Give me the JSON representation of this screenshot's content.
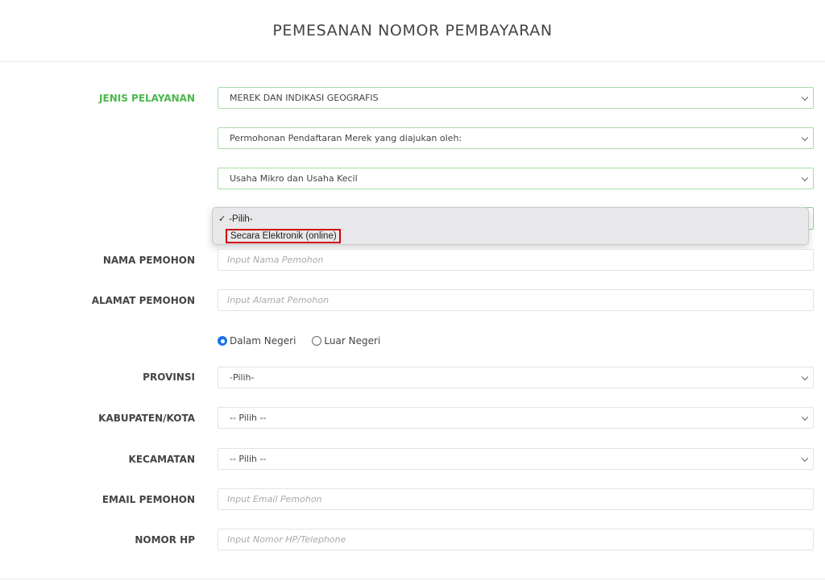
{
  "header": {
    "title": "PEMESANAN NOMOR PEMBAYARAN"
  },
  "form": {
    "jenis_pelayanan": {
      "label": "JENIS PELAYANAN",
      "select1": "MEREK DAN INDIKASI GEOGRAFIS",
      "select2": "Permohonan Pendaftaran Merek yang diajukan oleh:",
      "select3": "Usaha Mikro dan Usaha Kecil"
    },
    "dropdown": {
      "options": [
        "-Pilih-",
        "Secara Elektronik (online)"
      ],
      "checkmark": "✓",
      "selected_index": 0,
      "highlighted_option": "Secara Elektronik (online)"
    },
    "nama_pemohon": {
      "label": "NAMA PEMOHON",
      "placeholder": "Input Nama Pemohon"
    },
    "alamat_pemohon": {
      "label": "ALAMAT PEMOHON",
      "placeholder": "Input Alamat Pemohon"
    },
    "lokasi": {
      "options": [
        "Dalam Negeri",
        "Luar Negeri"
      ],
      "selected": "Dalam Negeri"
    },
    "provinsi": {
      "label": "PROVINSI",
      "value": "-Pilih-"
    },
    "kabupaten": {
      "label": "KABUPATEN/KOTA",
      "value": "-- Pilih --"
    },
    "kecamatan": {
      "label": "KECAMATAN",
      "value": "-- Pilih --"
    },
    "email_pemohon": {
      "label": "EMAIL PEMOHON",
      "placeholder": "Input Email Pemohon"
    },
    "nomor_hp": {
      "label": "NOMOR HP",
      "placeholder": "Input Nomor HP/Telephone"
    }
  },
  "colors": {
    "label_accent": "#4cb84c",
    "select_border": "#a6dca6",
    "highlight_box": "#d00000",
    "radio_selected": "#1a73e8"
  }
}
